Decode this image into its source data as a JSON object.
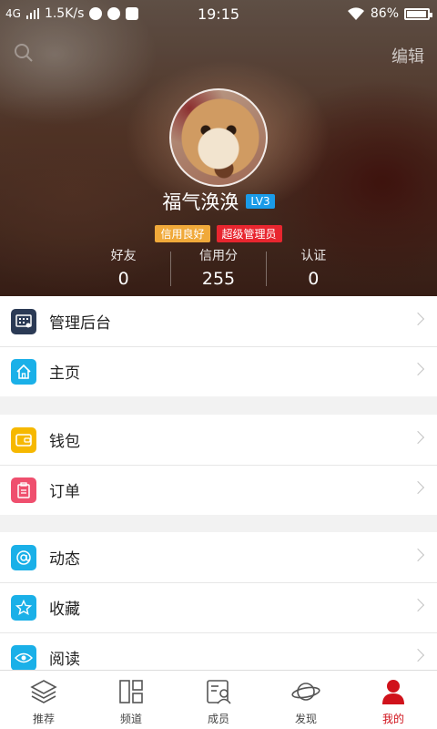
{
  "status_bar": {
    "network": "4G",
    "speed": "1.5K/s",
    "time": "19:15",
    "battery": "86%"
  },
  "header": {
    "edit_label": "编辑",
    "username": "福气涣涣",
    "level": "LV3",
    "badges": [
      "信用良好",
      "超级管理员"
    ],
    "stats": [
      {
        "label": "好友",
        "value": "0"
      },
      {
        "label": "信用分",
        "value": "255"
      },
      {
        "label": "认证",
        "value": "0"
      }
    ]
  },
  "menu": {
    "group1": [
      {
        "label": "管理后台",
        "icon": "admin-dashboard-icon",
        "color": "#2b3a55"
      },
      {
        "label": "主页",
        "icon": "home-icon",
        "color": "#1ab0e8"
      }
    ],
    "group2": [
      {
        "label": "钱包",
        "icon": "wallet-icon",
        "color": "#f6b800"
      },
      {
        "label": "订单",
        "icon": "clipboard-icon",
        "color": "#ef4f6e"
      }
    ],
    "group3": [
      {
        "label": "动态",
        "icon": "at-sign-icon",
        "color": "#1ab0e8"
      },
      {
        "label": "收藏",
        "icon": "star-icon",
        "color": "#1ab0e8"
      },
      {
        "label": "阅读",
        "icon": "eye-icon",
        "color": "#1ab0e8"
      }
    ]
  },
  "tabbar": {
    "tabs": [
      {
        "label": "推荐",
        "icon": "layers-icon"
      },
      {
        "label": "频道",
        "icon": "grid-icon"
      },
      {
        "label": "成员",
        "icon": "contact-card-icon"
      },
      {
        "label": "发现",
        "icon": "planet-icon"
      },
      {
        "label": "我的",
        "icon": "person-icon",
        "active": true
      }
    ],
    "active_color": "#d0121b"
  }
}
